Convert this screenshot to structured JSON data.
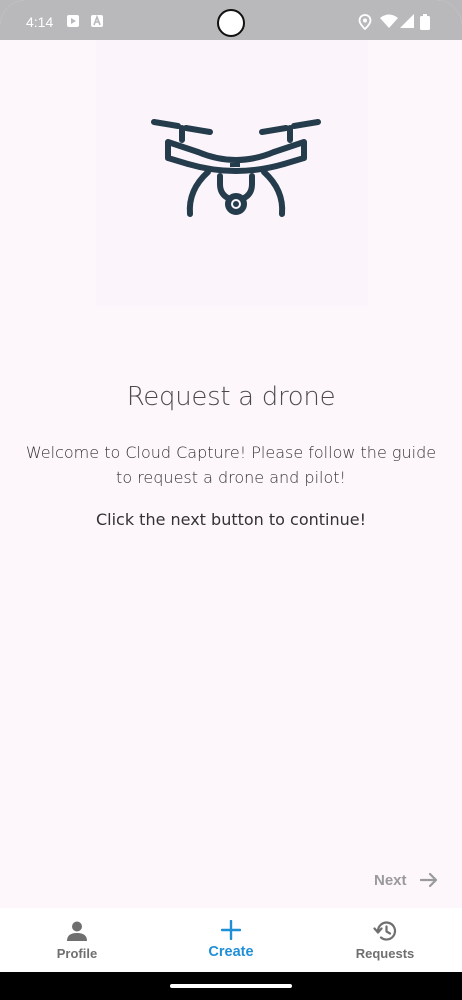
{
  "status_bar": {
    "time": "4:14",
    "left_icons": [
      "play-icon",
      "font-icon"
    ],
    "right_icons": [
      "location-icon",
      "wifi-icon",
      "signal-icon",
      "battery-icon"
    ]
  },
  "main": {
    "hero_icon": "drone-icon",
    "title": "Request a drone",
    "description": "Welcome to Cloud Capture! Please follow the guide to request a drone and pilot!",
    "instruction": "Click the next button to continue!",
    "next_label": "Next"
  },
  "bottom_nav": {
    "items": [
      {
        "label": "Profile",
        "icon": "person-icon",
        "active": false
      },
      {
        "label": "Create",
        "icon": "plus-icon",
        "active": true
      },
      {
        "label": "Requests",
        "icon": "history-icon",
        "active": false
      }
    ]
  },
  "colors": {
    "accent": "#1f8fd8",
    "drone": "#243c4c",
    "background": "#fdf7fc",
    "muted": "#9a9a9a"
  }
}
